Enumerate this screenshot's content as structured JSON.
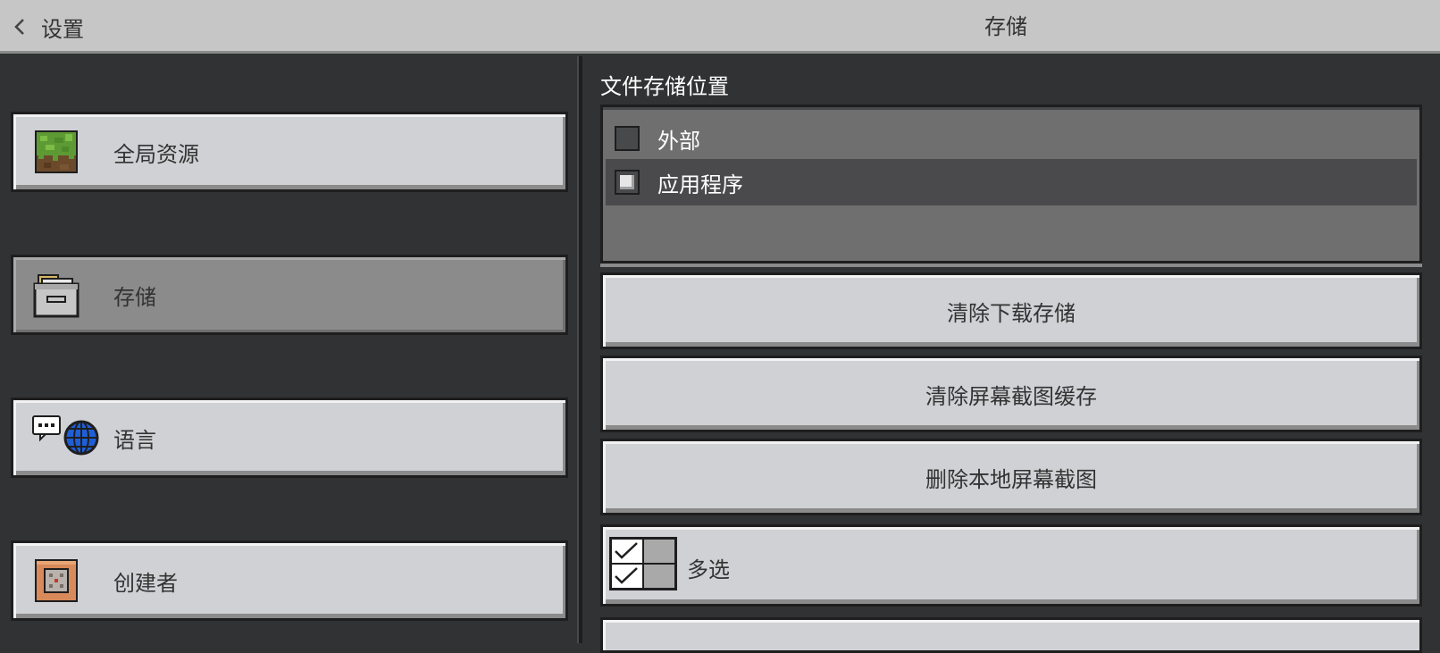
{
  "header": {
    "back_label": "设置",
    "title": "存储"
  },
  "sidebar": {
    "items": [
      {
        "label": "全局资源",
        "icon": "grass-block-icon",
        "selected": false
      },
      {
        "label": "存储",
        "icon": "storage-drawer-icon",
        "selected": true
      },
      {
        "label": "语言",
        "icon": "language-globe-icon",
        "selected": false
      },
      {
        "label": "创建者",
        "icon": "command-block-icon",
        "selected": false
      }
    ]
  },
  "storage": {
    "section_title": "文件存储位置",
    "options": [
      {
        "label": "外部",
        "checked": false
      },
      {
        "label": "应用程序",
        "checked": true
      }
    ],
    "buttons": {
      "clear_download": "清除下载存储",
      "clear_screenshot_cache": "清除屏幕截图缓存",
      "delete_local_screenshots": "删除本地屏幕截图"
    },
    "multi_select_label": "多选"
  },
  "colors": {
    "header_bg": "#c6c6c6",
    "panel_bg": "#313233",
    "button_bg": "#d0d1d4",
    "selected_bg": "#8b8b8b"
  }
}
